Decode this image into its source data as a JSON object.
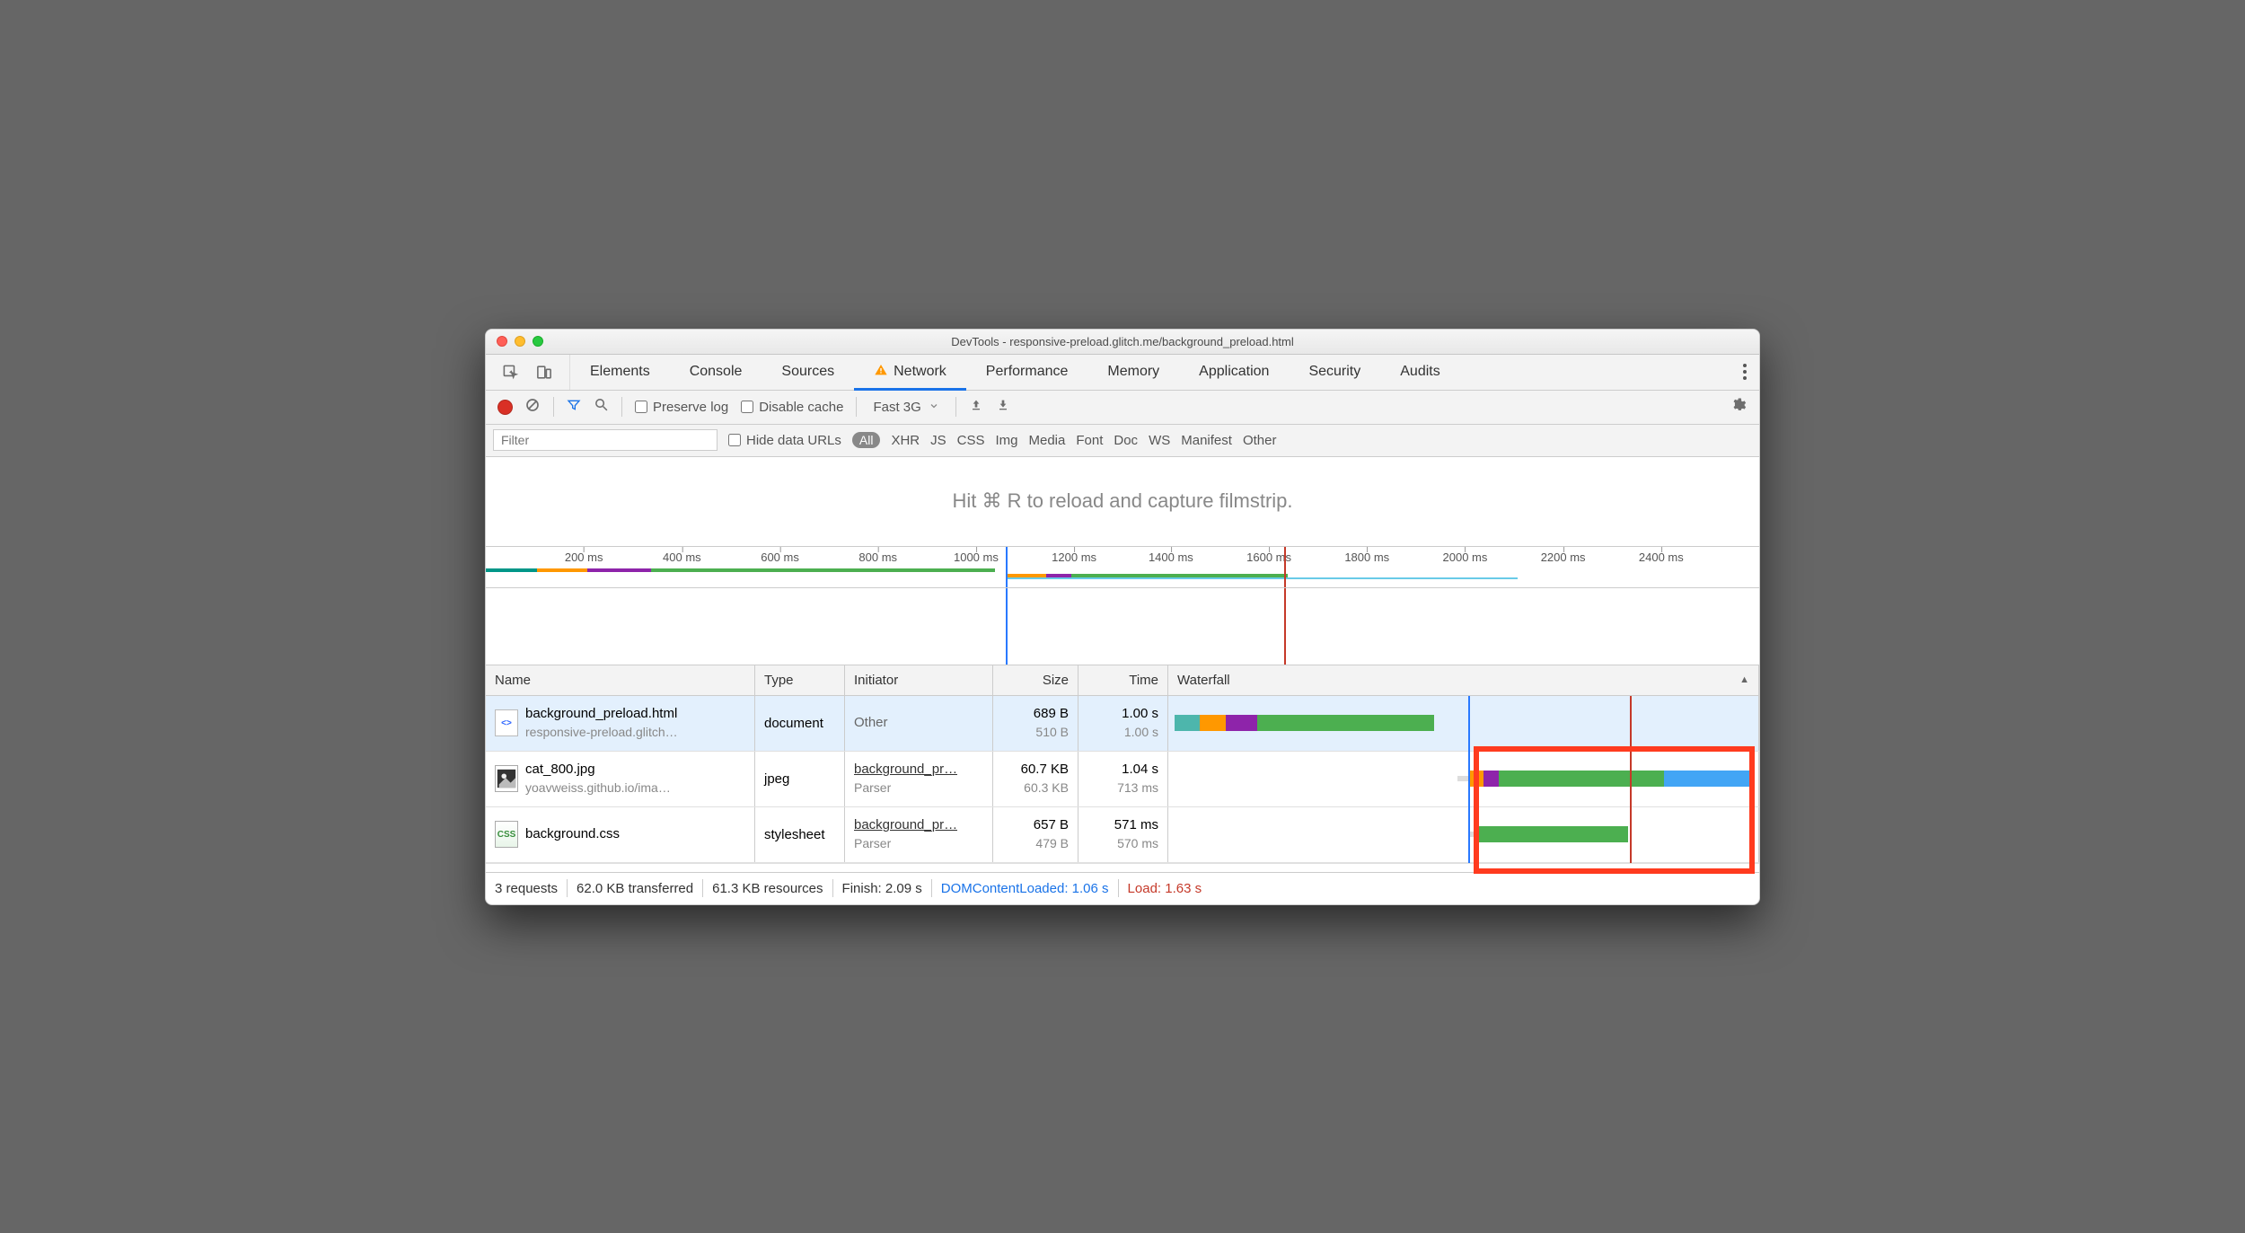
{
  "window": {
    "title": "DevTools - responsive-preload.glitch.me/background_preload.html"
  },
  "tabs": {
    "items": [
      "Elements",
      "Console",
      "Sources",
      "Network",
      "Performance",
      "Memory",
      "Application",
      "Security",
      "Audits"
    ],
    "active": "Network"
  },
  "toolbar": {
    "preserve_log": "Preserve log",
    "disable_cache": "Disable cache",
    "throttle": "Fast 3G"
  },
  "filter": {
    "placeholder": "Filter",
    "hide_data_urls": "Hide data URLs",
    "types": [
      "All",
      "XHR",
      "JS",
      "CSS",
      "Img",
      "Media",
      "Font",
      "Doc",
      "WS",
      "Manifest",
      "Other"
    ],
    "active_type": "All"
  },
  "filmstrip_hint": "Hit ⌘ R to reload and capture filmstrip.",
  "ruler": {
    "ticks": [
      "200 ms",
      "400 ms",
      "600 ms",
      "800 ms",
      "1000 ms",
      "1200 ms",
      "1400 ms",
      "1600 ms",
      "1800 ms",
      "2000 ms",
      "2200 ms",
      "2400 ms"
    ]
  },
  "columns": {
    "name": "Name",
    "type": "Type",
    "initiator": "Initiator",
    "size": "Size",
    "time": "Time",
    "waterfall": "Waterfall"
  },
  "rows": [
    {
      "name": "background_preload.html",
      "sub": "responsive-preload.glitch…",
      "type": "document",
      "initiator": "Other",
      "initiator_sub": "",
      "size": "689 B",
      "size_sub": "510 B",
      "time": "1.00 s",
      "time_sub": "1.00 s"
    },
    {
      "name": "cat_800.jpg",
      "sub": "yoavweiss.github.io/ima…",
      "type": "jpeg",
      "initiator": "background_pr…",
      "initiator_sub": "Parser",
      "size": "60.7 KB",
      "size_sub": "60.3 KB",
      "time": "1.04 s",
      "time_sub": "713 ms"
    },
    {
      "name": "background.css",
      "sub": "",
      "type": "stylesheet",
      "initiator": "background_pr…",
      "initiator_sub": "Parser",
      "size": "657 B",
      "size_sub": "479 B",
      "time": "571 ms",
      "time_sub": "570 ms"
    }
  ],
  "status": {
    "requests": "3 requests",
    "transferred": "62.0 KB transferred",
    "resources": "61.3 KB resources",
    "finish": "Finish: 2.09 s",
    "dcl": "DOMContentLoaded: 1.06 s",
    "load": "Load: 1.63 s"
  }
}
